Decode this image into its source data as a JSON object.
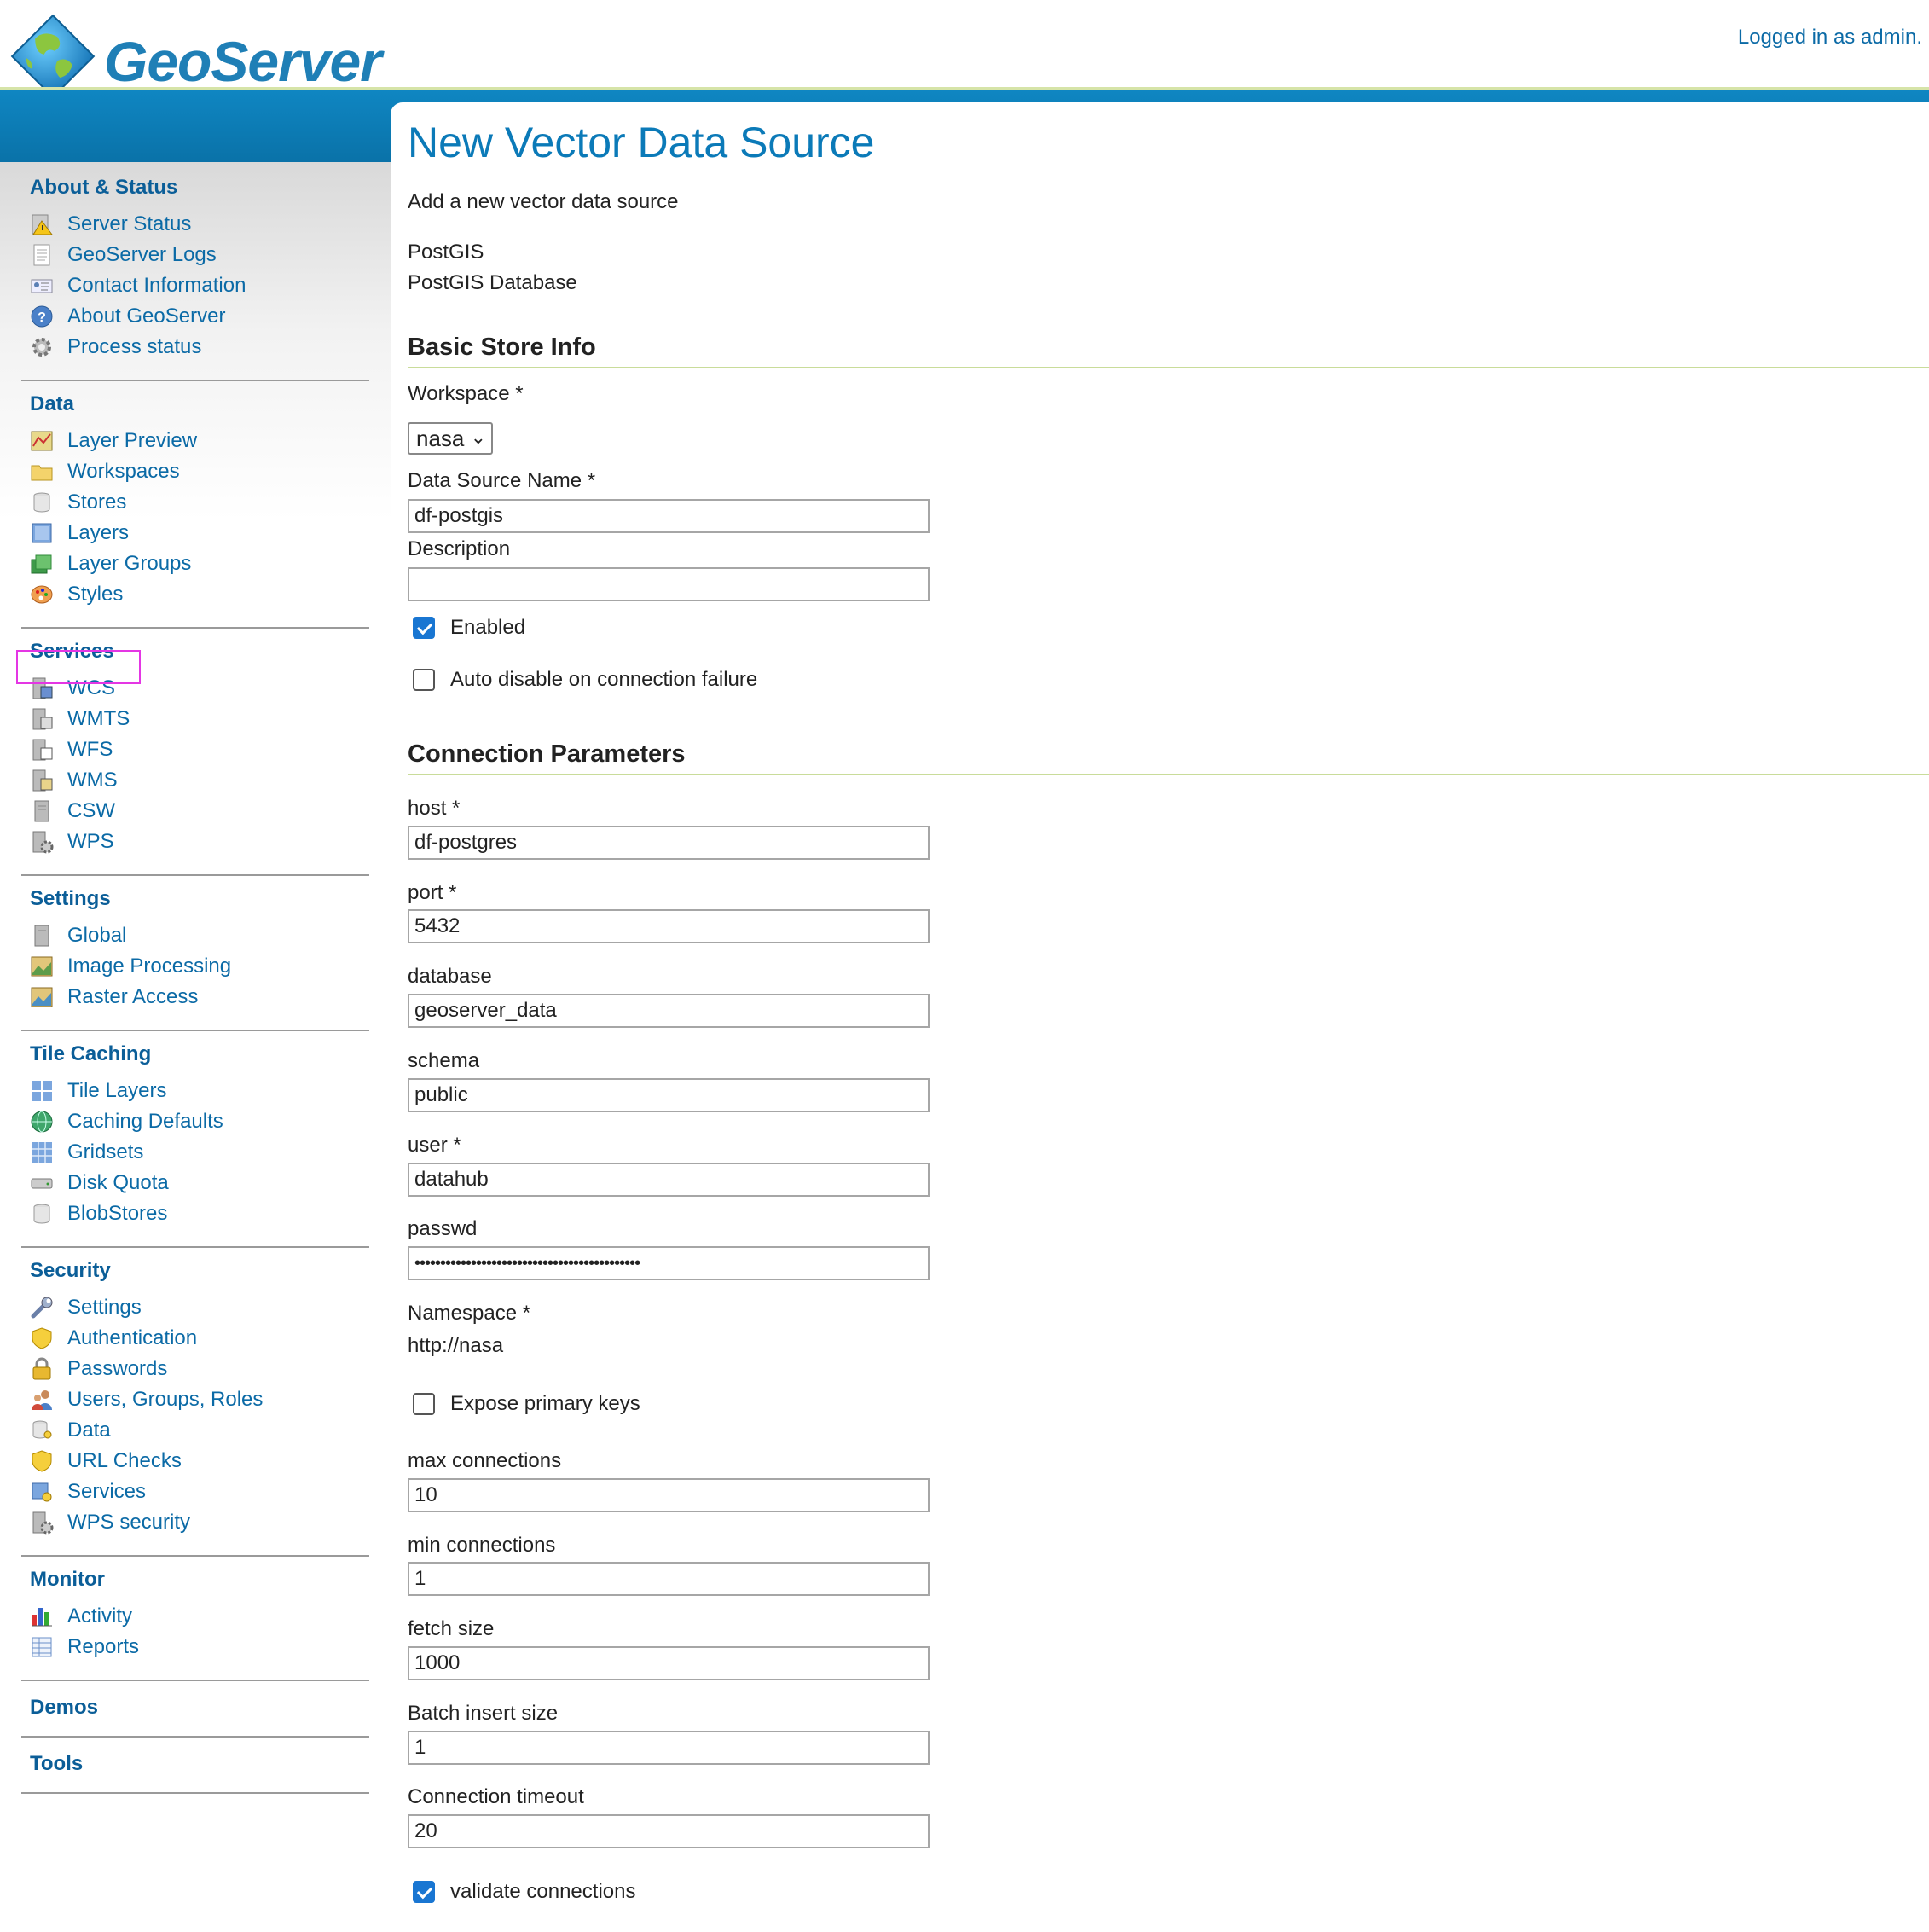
{
  "header": {
    "logo_text": "GeoServer",
    "login_status": "Logged in as admin."
  },
  "sidebar": {
    "sections": [
      {
        "title": "About & Status",
        "items": [
          "Server Status",
          "GeoServer Logs",
          "Contact Information",
          "About GeoServer",
          "Process status"
        ]
      },
      {
        "title": "Data",
        "items": [
          "Layer Preview",
          "Workspaces",
          "Stores",
          "Layers",
          "Layer Groups",
          "Styles"
        ]
      },
      {
        "title": "Services",
        "items": [
          "WCS",
          "WMTS",
          "WFS",
          "WMS",
          "CSW",
          "WPS"
        ]
      },
      {
        "title": "Settings",
        "items": [
          "Global",
          "Image Processing",
          "Raster Access"
        ]
      },
      {
        "title": "Tile Caching",
        "items": [
          "Tile Layers",
          "Caching Defaults",
          "Gridsets",
          "Disk Quota",
          "BlobStores"
        ]
      },
      {
        "title": "Security",
        "items": [
          "Settings",
          "Authentication",
          "Passwords",
          "Users, Groups, Roles",
          "Data",
          "URL Checks",
          "Services",
          "WPS security"
        ]
      },
      {
        "title": "Monitor",
        "items": [
          "Activity",
          "Reports"
        ]
      },
      {
        "title": "Demos",
        "items": []
      },
      {
        "title": "Tools",
        "items": []
      }
    ],
    "highlighted_item": "Stores"
  },
  "main": {
    "title": "New Vector Data Source",
    "subtitle": "Add a new vector data source",
    "store_type": "PostGIS",
    "store_type_desc": "PostGIS Database",
    "basic_heading": "Basic Store Info",
    "workspace_label": "Workspace *",
    "workspace_value": "nasa",
    "name_label": "Data Source Name *",
    "name_value": "df-postgis",
    "description_label": "Description",
    "description_value": "",
    "enabled_label": "Enabled",
    "enabled": true,
    "auto_disable_label": "Auto disable on connection failure",
    "auto_disable": false,
    "conn_heading": "Connection Parameters",
    "host_label": "host *",
    "host_value": "df-postgres",
    "port_label": "port *",
    "port_value": "5432",
    "database_label": "database",
    "database_value": "geoserver_data",
    "schema_label": "schema",
    "schema_value": "public",
    "user_label": "user *",
    "user_value": "datahub",
    "passwd_label": "passwd",
    "passwd_value": "••••••••••••••••••••••••••••••••••••••••••••",
    "namespace_label": "Namespace *",
    "namespace_value": "http://nasa",
    "expose_pk_label": "Expose primary keys",
    "expose_pk": false,
    "max_conn_label": "max connections",
    "max_conn_value": "10",
    "min_conn_label": "min connections",
    "min_conn_value": "1",
    "fetch_label": "fetch size",
    "fetch_value": "1000",
    "batch_label": "Batch insert size",
    "batch_value": "1",
    "timeout_label": "Connection timeout",
    "timeout_value": "20",
    "validate_label": "validate connections",
    "validate": true
  },
  "colors": {
    "link": "#0b6aa6",
    "title": "#0b7ab8",
    "band": "#0d7fb9",
    "section_rule": "#c9dc9a",
    "highlight": "#e436e4",
    "checkbox": "#1976d2"
  }
}
